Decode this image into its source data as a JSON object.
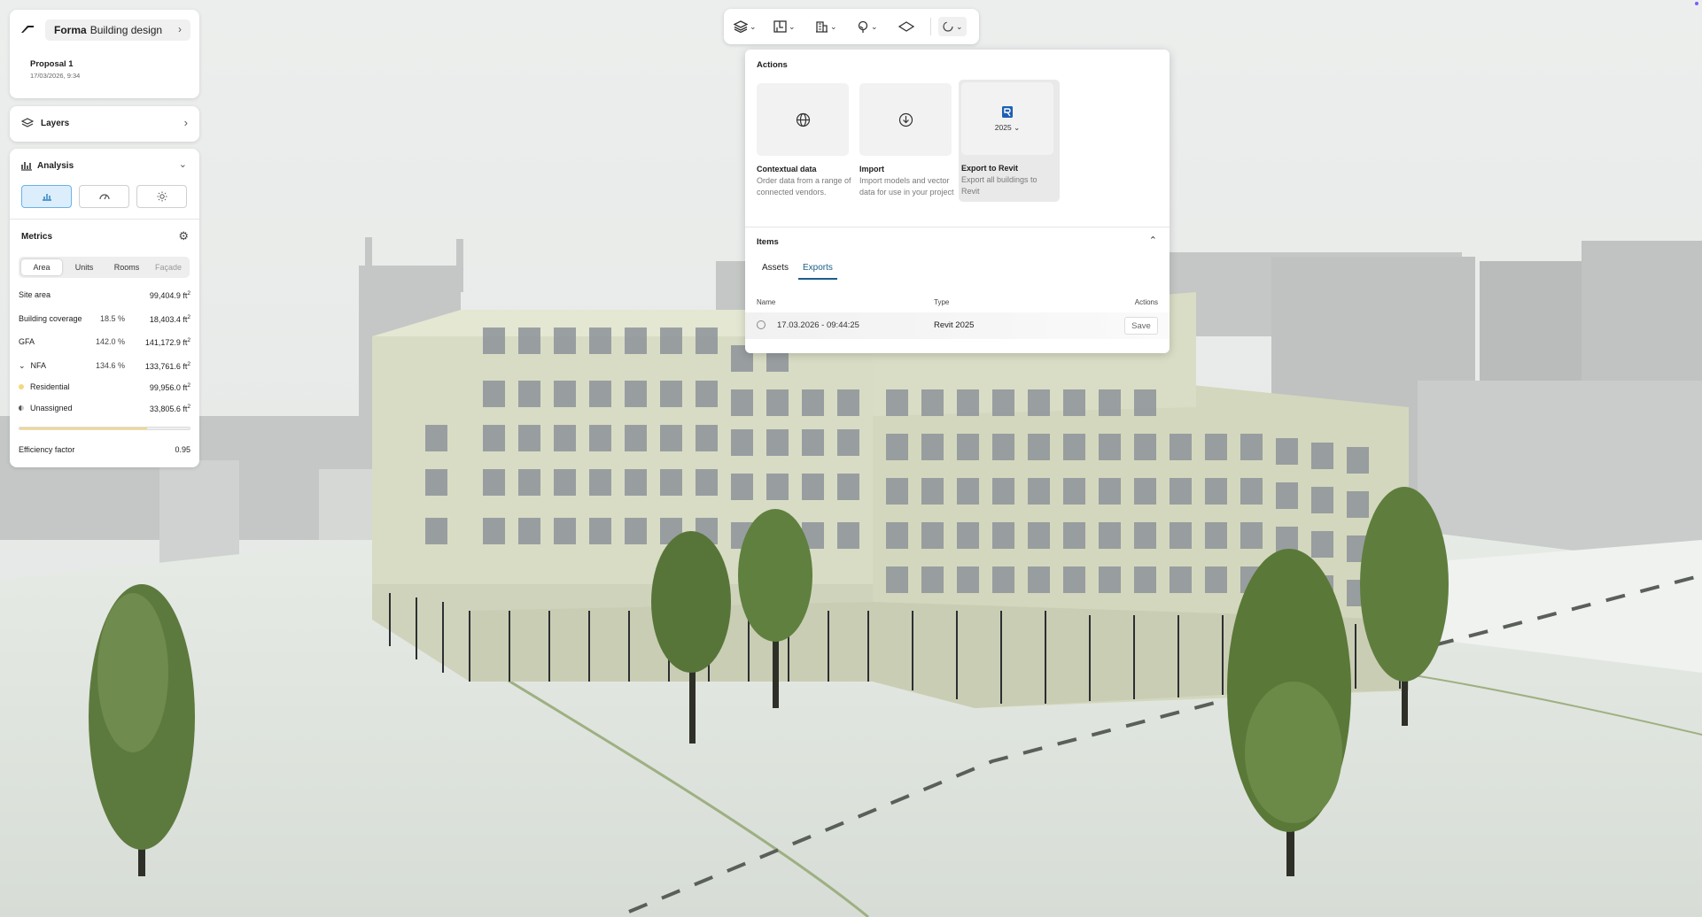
{
  "app": {
    "brand_bold": "Forma",
    "brand_rest": "Building design",
    "proposal_name": "Proposal 1",
    "proposal_date": "17/03/2026, 9:34"
  },
  "layers": {
    "label": "Layers"
  },
  "analysis": {
    "label": "Analysis",
    "metrics_label": "Metrics",
    "tabs": [
      "Area",
      "Units",
      "Rooms",
      "Façade"
    ],
    "rows": [
      {
        "key": "Site area",
        "pct": "",
        "value": "99,404.9 ft",
        "unit_sup": "2"
      },
      {
        "key": "Building coverage",
        "pct": "18.5 %",
        "value": "18,403.4 ft",
        "unit_sup": "2"
      },
      {
        "key": "GFA",
        "pct": "142.0 %",
        "value": "141,172.9 ft",
        "unit_sup": "2"
      },
      {
        "key": "NFA",
        "pct": "134.6 %",
        "value": "133,761.6 ft",
        "unit_sup": "2"
      },
      {
        "key": "Residential",
        "pct": "",
        "value": "99,956.0 ft",
        "unit_sup": "2"
      },
      {
        "key": "Unassigned",
        "pct": "",
        "value": "33,805.6 ft",
        "unit_sup": "2"
      }
    ],
    "nfa_toggle": "⌄",
    "progress_fraction": 0.75,
    "efficiency_label": "Efficiency factor",
    "efficiency_value": "0.95",
    "colors": {
      "residential": "#f4d880",
      "unassigned": "#555555",
      "active_accent": "#2a7fc0"
    }
  },
  "toolbar": {
    "icons": [
      "layers-icon",
      "floorplan-icon",
      "building-icon",
      "tree-icon",
      "plane-icon",
      "spinner-icon"
    ]
  },
  "actions_panel": {
    "title": "Actions",
    "actions": [
      {
        "name": "Contextual data",
        "desc": "Order data from a range of connected vendors."
      },
      {
        "name": "Import",
        "desc": "Import models and vector data for use in your project"
      },
      {
        "name": "Export to Revit",
        "desc": "Export all buildings to Revit",
        "version": "2025"
      }
    ],
    "items_title": "Items",
    "tabs": [
      "Assets",
      "Exports"
    ],
    "active_tab": "Exports",
    "columns": [
      "Name",
      "Type",
      "Actions"
    ],
    "rows": [
      {
        "name": "17.03.2026 - 09:44:25",
        "type": "Revit 2025",
        "action": "Save"
      }
    ],
    "colors": {
      "accent": "#1b5e86"
    }
  }
}
